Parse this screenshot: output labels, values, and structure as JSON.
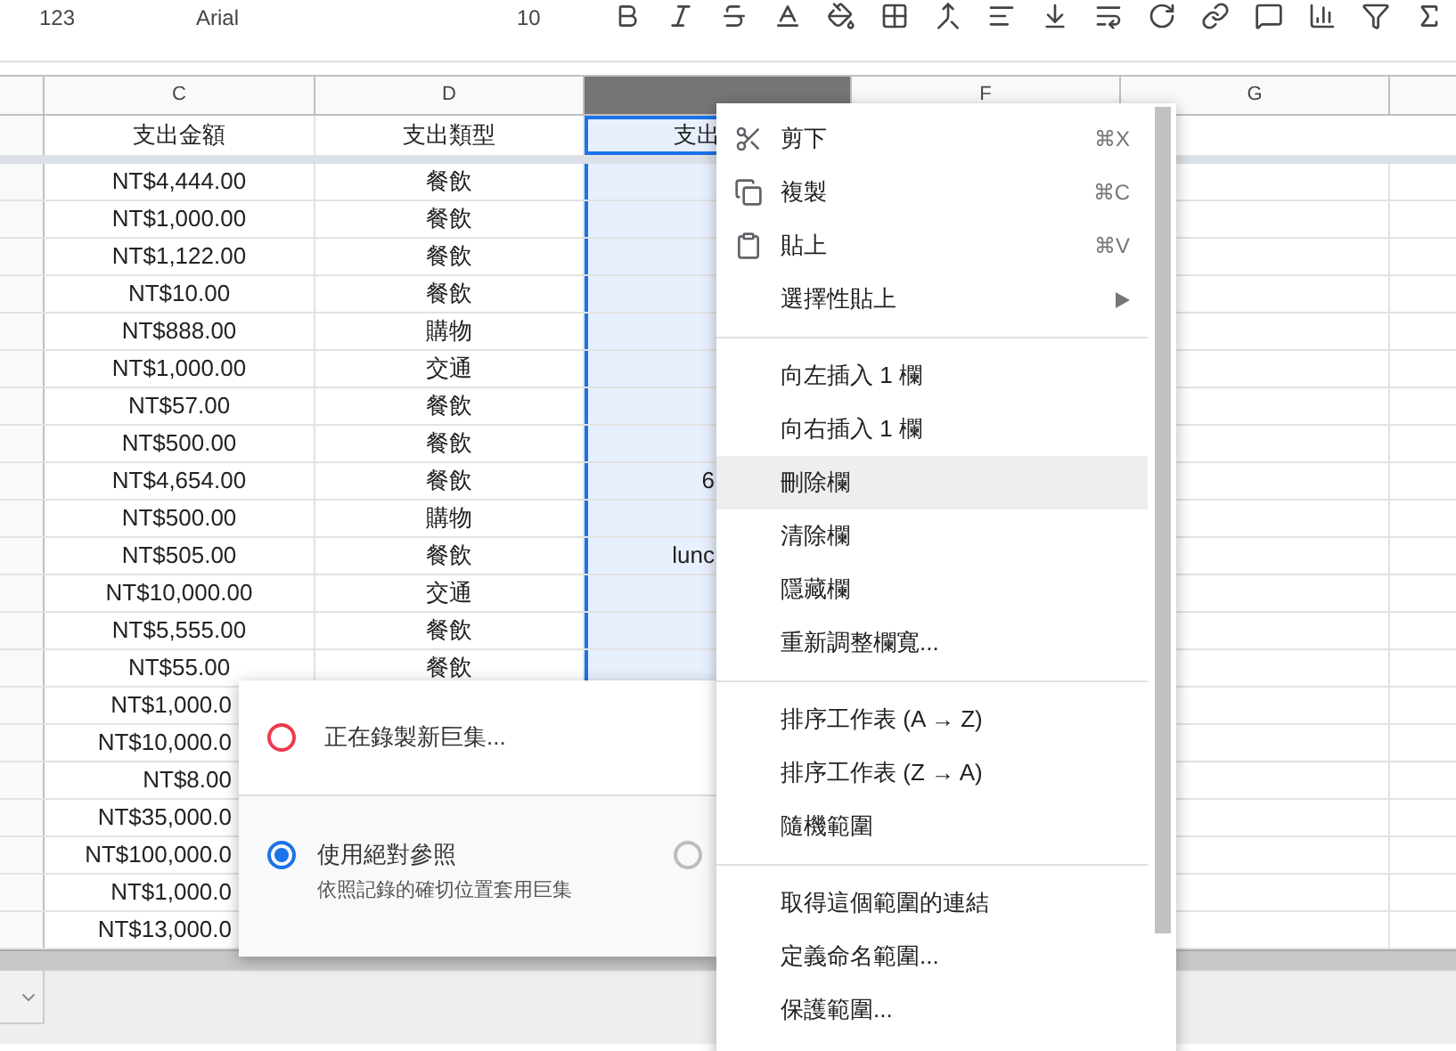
{
  "toolbar": {
    "number_format": "123",
    "font": "Arial",
    "font_size": "10"
  },
  "columns": [
    {
      "letter": "C",
      "selected": false
    },
    {
      "letter": "D",
      "selected": false
    },
    {
      "selected": true
    },
    {
      "letter": "F",
      "selected": false
    },
    {
      "letter": "G",
      "selected": false
    }
  ],
  "header_row": {
    "c": "支出金額",
    "d": "支出類型",
    "e": "支出"
  },
  "rows": [
    {
      "c": "NT$4,444.00",
      "d": "餐飲"
    },
    {
      "c": "NT$1,000.00",
      "d": "餐飲"
    },
    {
      "c": "NT$1,122.00",
      "d": "餐飲"
    },
    {
      "c": "NT$10.00",
      "d": "餐飲"
    },
    {
      "c": "NT$888.00",
      "d": "購物"
    },
    {
      "c": "NT$1,000.00",
      "d": "交通"
    },
    {
      "c": "NT$57.00",
      "d": "餐飲"
    },
    {
      "c": "NT$500.00",
      "d": "餐飲"
    },
    {
      "c": "NT$4,654.00",
      "d": "餐飲",
      "e": "6"
    },
    {
      "c": "NT$500.00",
      "d": "購物"
    },
    {
      "c": "NT$505.00",
      "d": "餐飲",
      "e": "lunc"
    },
    {
      "c": "NT$10,000.00",
      "d": "交通"
    },
    {
      "c": "NT$5,555.00",
      "d": "餐飲"
    },
    {
      "c": "NT$55.00",
      "d": "餐飲"
    },
    {
      "c": "NT$1,000.0"
    },
    {
      "c": "NT$10,000.0"
    },
    {
      "c": "NT$8.00"
    },
    {
      "c": "NT$35,000.0"
    },
    {
      "c": "NT$100,000.0"
    },
    {
      "c": "NT$1,000.0"
    },
    {
      "c": "NT$13,000.0"
    }
  ],
  "context_menu": {
    "items": [
      {
        "kind": "cut",
        "label": "剪下",
        "shortcut": "⌘X",
        "highlighted": false
      },
      {
        "kind": "copy",
        "label": "複製",
        "shortcut": "⌘C",
        "highlighted": false
      },
      {
        "kind": "paste",
        "label": "貼上",
        "shortcut": "⌘V",
        "highlighted": false
      },
      {
        "kind": "submenu",
        "label": "選擇性貼上",
        "highlighted": false
      },
      {
        "kind": "divider"
      },
      {
        "kind": "item",
        "label": "向左插入 1 欄",
        "highlighted": false
      },
      {
        "kind": "item",
        "label": "向右插入 1 欄",
        "highlighted": false
      },
      {
        "kind": "item",
        "label": "刪除欄",
        "highlighted": true
      },
      {
        "kind": "item",
        "label": "清除欄",
        "highlighted": false
      },
      {
        "kind": "item",
        "label": "隱藏欄",
        "highlighted": false
      },
      {
        "kind": "item",
        "label": "重新調整欄寬...",
        "highlighted": false
      },
      {
        "kind": "divider"
      },
      {
        "kind": "item",
        "label": "排序工作表 (A → Z)",
        "highlighted": false
      },
      {
        "kind": "item",
        "label": "排序工作表 (Z → A)",
        "highlighted": false
      },
      {
        "kind": "item",
        "label": "隨機範圍",
        "highlighted": false
      },
      {
        "kind": "divider"
      },
      {
        "kind": "item",
        "label": "取得這個範圍的連結",
        "highlighted": false
      },
      {
        "kind": "item",
        "label": "定義命名範圍...",
        "highlighted": false
      },
      {
        "kind": "item",
        "label": "保護範圍...",
        "highlighted": false
      }
    ]
  },
  "macro_panel": {
    "record": {
      "label": "正在錄製新巨集..."
    },
    "options": [
      {
        "label": "使用絕對參照",
        "description": "依照記錄的確切位置套用巨集",
        "selected": true
      },
      {
        "selected": false
      }
    ]
  }
}
